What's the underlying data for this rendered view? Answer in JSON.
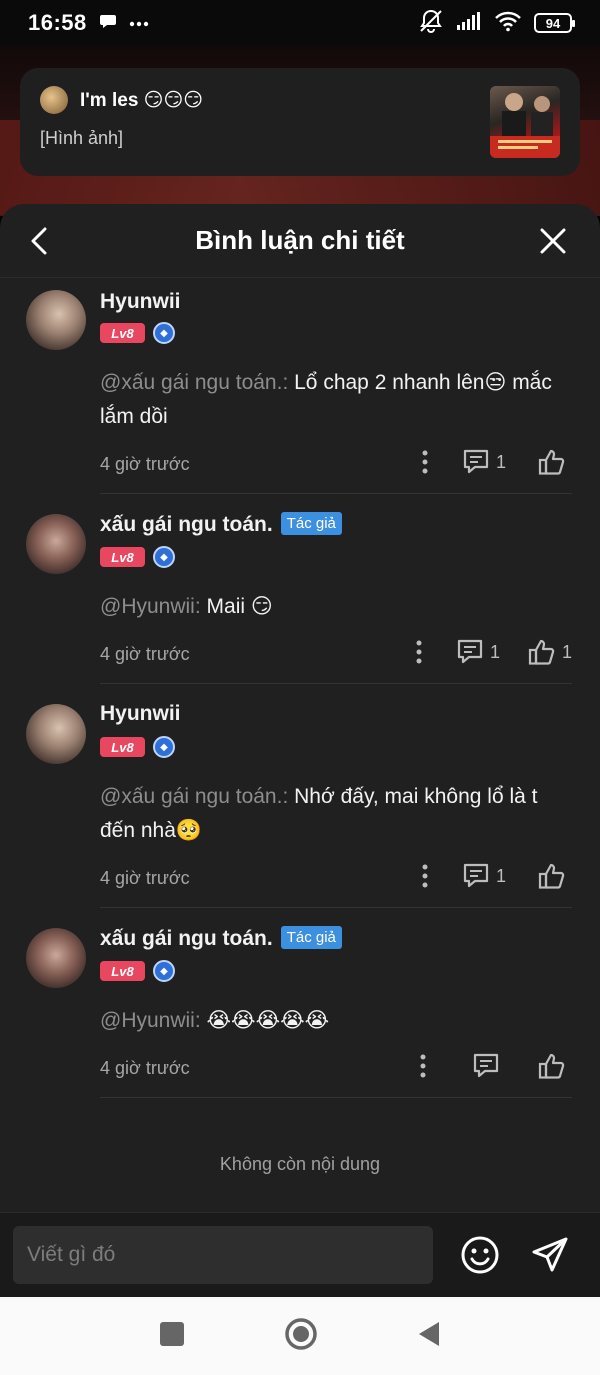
{
  "status_bar": {
    "time": "16:58",
    "battery": "94"
  },
  "toast": {
    "title": "I'm les 😏😏😏",
    "subtitle": "[Hình ảnh]"
  },
  "sheet": {
    "title": "Bình luận chi tiết"
  },
  "comments": [
    {
      "name": "Hyunwii",
      "author_tag": "",
      "level": "Lv8",
      "mention": "@xấu gái ngu toán.:",
      "text": " Lổ chap 2 nhanh lên😒 mắc lắm dồi",
      "time": "4 giờ trước",
      "reply_count": "1",
      "like_count": ""
    },
    {
      "name": "xấu gái ngu toán.",
      "author_tag": "Tác giả",
      "level": "Lv8",
      "mention": "@Hyunwii:",
      "text": " Maii 😏",
      "time": "4 giờ trước",
      "reply_count": "1",
      "like_count": "1"
    },
    {
      "name": "Hyunwii",
      "author_tag": "",
      "level": "Lv8",
      "mention": "@xấu gái ngu toán.:",
      "text": " Nhớ đấy, mai không lổ là t đến nhà🥺",
      "time": "4 giờ trước",
      "reply_count": "1",
      "like_count": ""
    },
    {
      "name": "xấu gái ngu toán.",
      "author_tag": "Tác giả",
      "level": "Lv8",
      "mention": "@Hyunwii:",
      "text": " 😭😭😭😭😭",
      "time": "4 giờ trước",
      "reply_count": "",
      "like_count": ""
    }
  ],
  "footer": {
    "no_more": "Không còn nội dung"
  },
  "input": {
    "placeholder": "Viết gì đó"
  },
  "colors": {
    "sheet_bg": "#202020",
    "author_tag": "#3d8fe0",
    "level_badge": "#e8475f"
  }
}
